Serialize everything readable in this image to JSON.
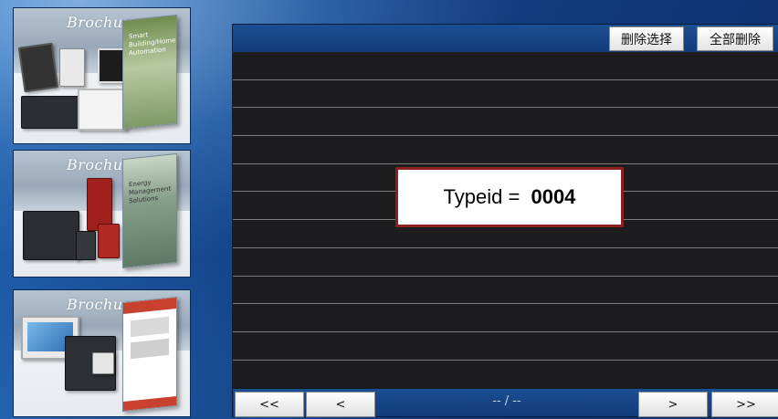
{
  "brochures": [
    {
      "title": "Brochure",
      "book_lines": [
        "Smart",
        "Building/Home",
        "Automation"
      ]
    },
    {
      "title": "Brochure",
      "book_lines": [
        "Energy",
        "Management",
        "Solutions"
      ]
    },
    {
      "title": "Brochure",
      "book_lines": []
    }
  ],
  "list": {
    "delete_selected_label": "删除选择",
    "delete_all_label": "全部删除",
    "row_count": 12
  },
  "footer": {
    "first_label": "<<",
    "prev_label": "<",
    "page_indicator": "-- / --",
    "next_label": ">",
    "last_label": ">>"
  },
  "overlay": {
    "prefix": "Typeid = ",
    "value": "0004"
  },
  "colors": {
    "overlay_border": "#8c1f1f",
    "header_blue": "#1a4e93",
    "list_bg": "#1a1a1c"
  }
}
